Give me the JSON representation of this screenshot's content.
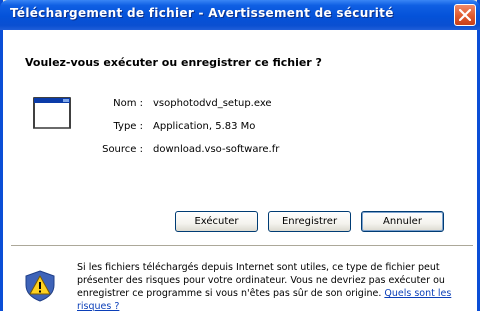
{
  "window": {
    "title": "Téléchargement de fichier - Avertissement de sécurité"
  },
  "question": "Voulez-vous exécuter ou enregistrer ce fichier ?",
  "file": {
    "name_label": "Nom :",
    "name_value": "vsophotodvd_setup.exe",
    "type_label": "Type :",
    "type_value": "Application, 5.83 Mo",
    "source_label": "Source :",
    "source_value": "download.vso-software.fr",
    "icon": "application-icon"
  },
  "buttons": {
    "execute": "Exécuter",
    "save": "Enregistrer",
    "cancel": "Annuler"
  },
  "warning": {
    "icon": "shield-warning-icon",
    "text": "Si les fichiers téléchargés depuis Internet sont utiles, ce type de fichier peut présenter des risques pour votre ordinateur. Vous ne devriez pas exécuter ou enregistrer ce programme si vous n'êtes pas sûr de son origine.",
    "link": "Quels sont les risques ?"
  },
  "colors": {
    "titlebar": "#0452d9",
    "border": "#0a4ed6",
    "close_button": "#e05a2d",
    "link": "#0b3fb8"
  }
}
